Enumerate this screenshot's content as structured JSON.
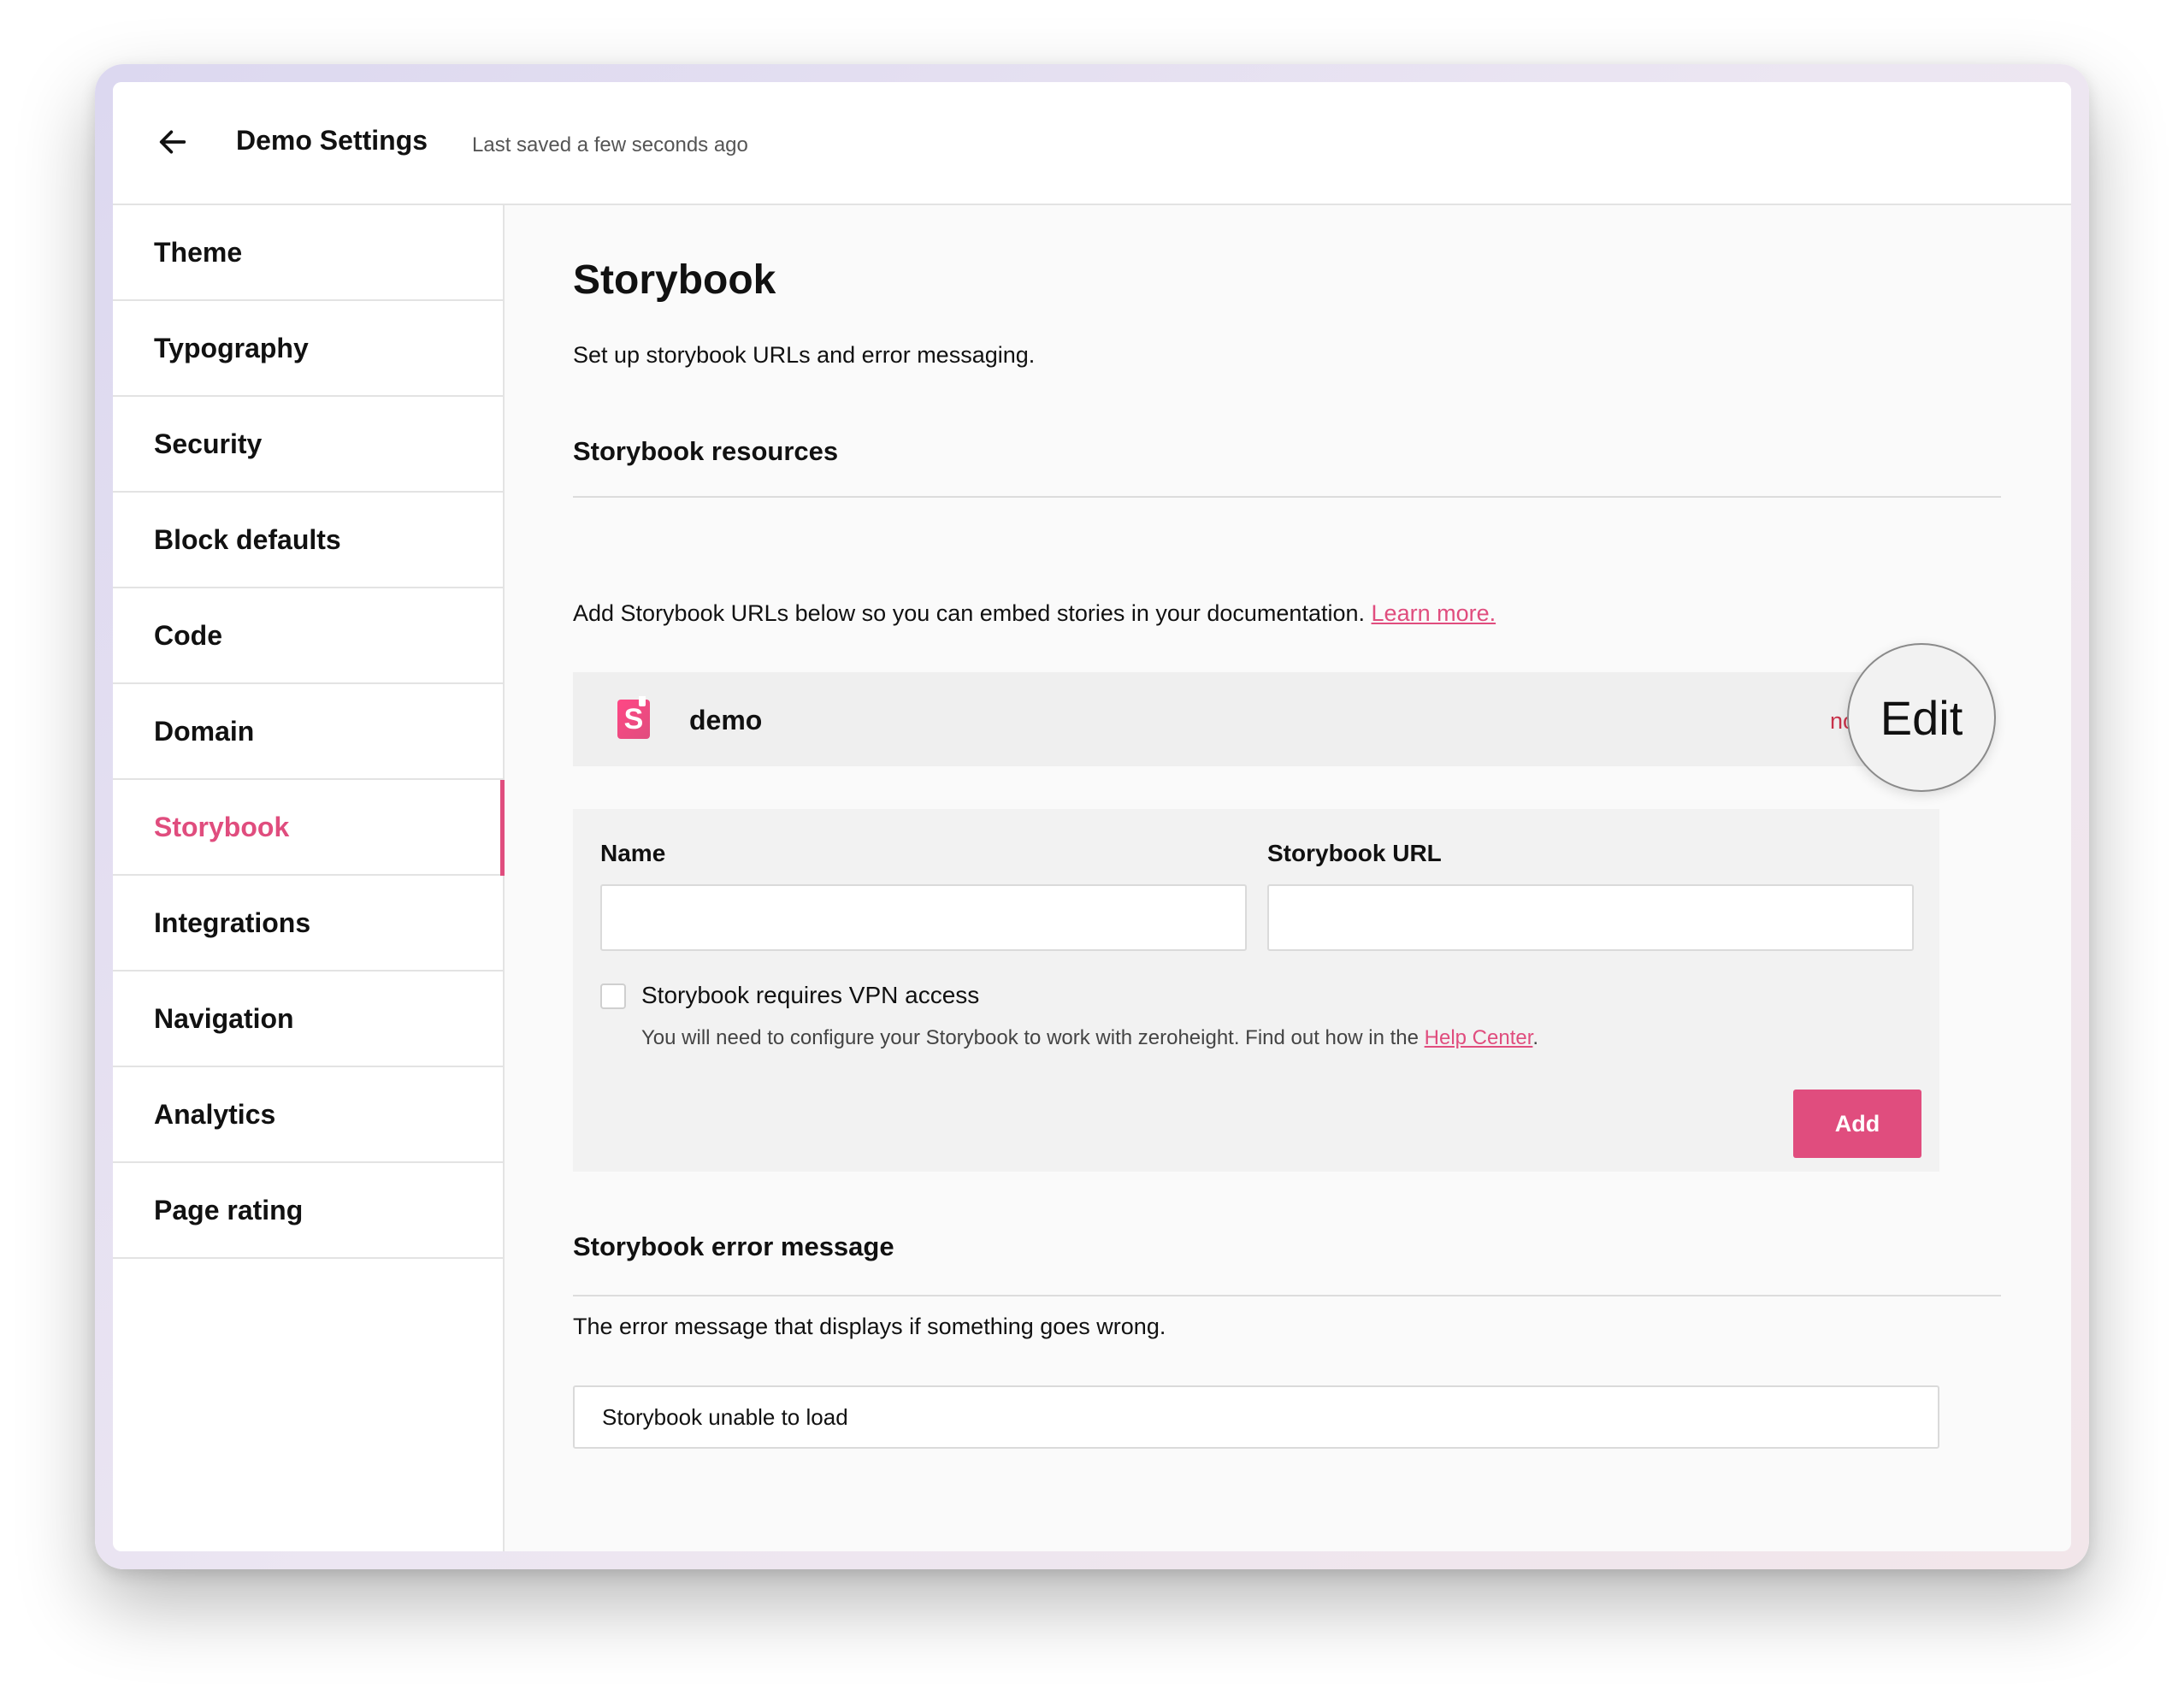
{
  "header": {
    "title": "Demo Settings",
    "status": "Last saved a few seconds ago"
  },
  "sidebar": {
    "items": [
      {
        "label": "Theme"
      },
      {
        "label": "Typography"
      },
      {
        "label": "Security"
      },
      {
        "label": "Block defaults"
      },
      {
        "label": "Code"
      },
      {
        "label": "Domain"
      },
      {
        "label": "Storybook",
        "active": true
      },
      {
        "label": "Integrations"
      },
      {
        "label": "Navigation"
      },
      {
        "label": "Analytics"
      },
      {
        "label": "Page rating"
      }
    ]
  },
  "main": {
    "title": "Storybook",
    "subtitle": "Set up storybook URLs and error messaging.",
    "resources": {
      "heading": "Storybook resources",
      "description": "Add Storybook URLs below so you can embed stories in your documentation.",
      "learn_more": "Learn more.",
      "items": [
        {
          "name": "demo",
          "logo_letter": "S",
          "remove_label": "nove",
          "edit_label": "Edit"
        }
      ]
    },
    "form": {
      "name_label": "Name",
      "name_value": "",
      "url_label": "Storybook URL",
      "url_value": "",
      "vpn_label": "Storybook requires VPN access",
      "vpn_checked": false,
      "vpn_help": "You will need to configure your Storybook to work with zeroheight. Find out how in the",
      "help_link": "Help Center",
      "help_suffix": ".",
      "add_label": "Add"
    },
    "error": {
      "heading": "Storybook error message",
      "description": "The error message that displays if something goes wrong.",
      "value": "Storybook unable to load"
    }
  },
  "colors": {
    "accent": "#e04d7e",
    "remove": "#c8324a",
    "panel": "#f2f2f2"
  },
  "icons": {
    "back": "arrow-left-icon",
    "storybook": "storybook-logo-icon"
  }
}
